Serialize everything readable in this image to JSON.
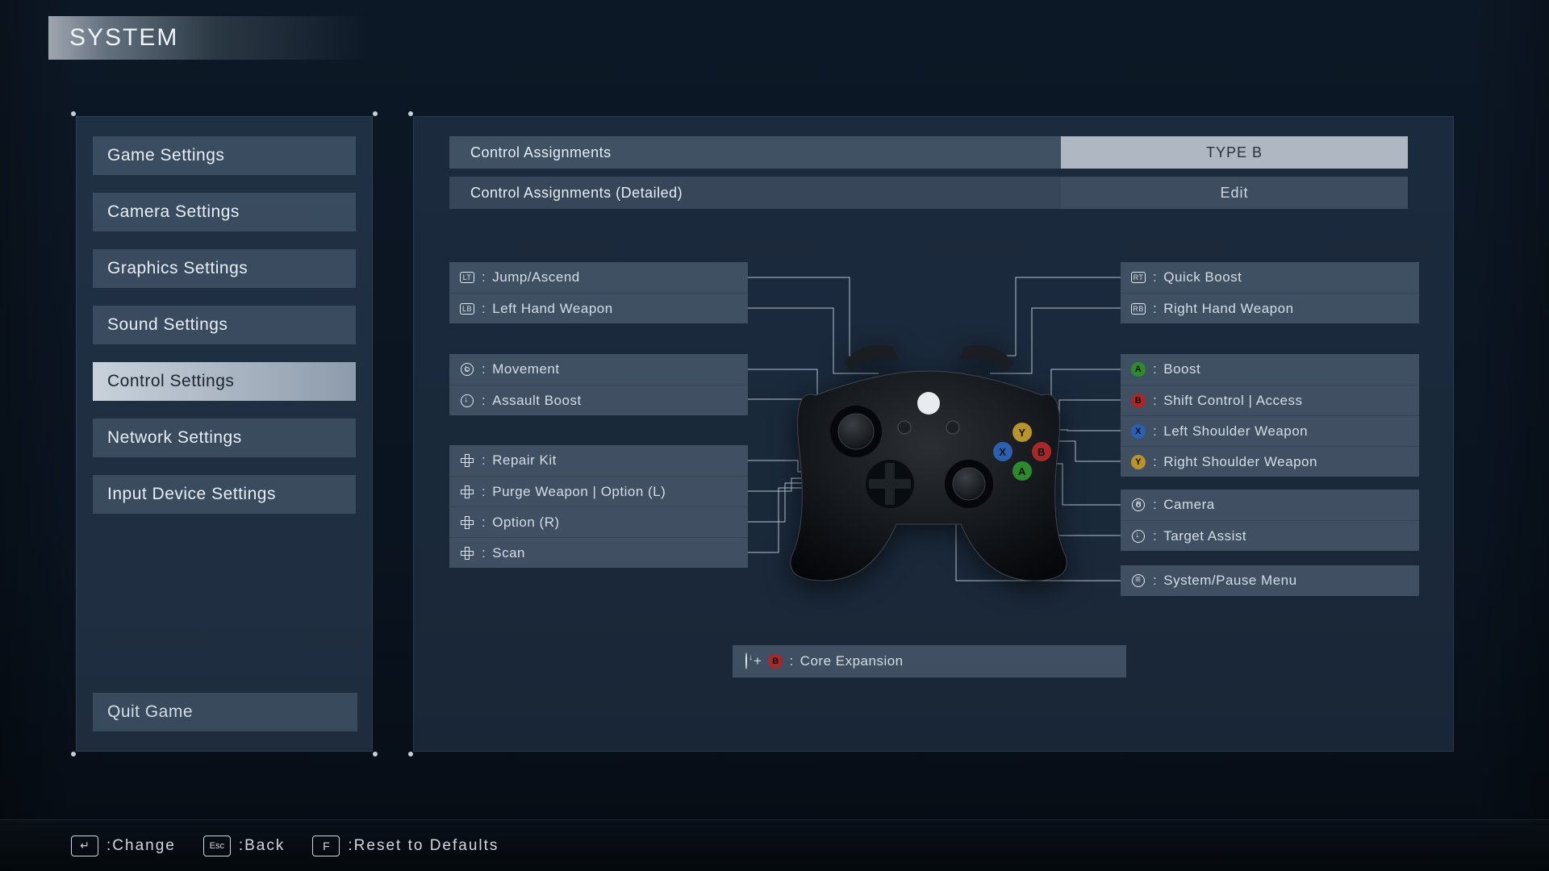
{
  "title": "SYSTEM",
  "sidebar": {
    "items": [
      {
        "label": "Game Settings",
        "active": false
      },
      {
        "label": "Camera Settings",
        "active": false
      },
      {
        "label": "Graphics Settings",
        "active": false
      },
      {
        "label": "Sound Settings",
        "active": false
      },
      {
        "label": "Control Settings",
        "active": true
      },
      {
        "label": "Network Settings",
        "active": false
      },
      {
        "label": "Input Device Settings",
        "active": false
      }
    ],
    "quit": "Quit Game"
  },
  "header": {
    "assignments_label": "Control Assignments",
    "assignments_value": "TYPE B",
    "detailed_label": "Control Assignments (Detailed)",
    "detailed_value": "Edit"
  },
  "bindings": {
    "left": [
      [
        {
          "icon": "LT",
          "label": "Jump/Ascend"
        },
        {
          "icon": "LB",
          "label": "Left Hand Weapon"
        }
      ],
      [
        {
          "icon": "LS",
          "label": "Movement"
        },
        {
          "icon": "LSP",
          "label": "Assault Boost"
        }
      ],
      [
        {
          "icon": "DPAD",
          "label": "Repair Kit"
        },
        {
          "icon": "DPAD",
          "label": "Purge Weapon | Option (L)"
        },
        {
          "icon": "DPAD",
          "label": "Option (R)"
        },
        {
          "icon": "DPAD",
          "label": "Scan"
        }
      ]
    ],
    "right": [
      [
        {
          "icon": "RT",
          "label": "Quick Boost"
        },
        {
          "icon": "RB",
          "label": "Right Hand Weapon"
        }
      ],
      [
        {
          "icon": "A",
          "label": "Boost"
        },
        {
          "icon": "B",
          "label": "Shift Control | Access"
        },
        {
          "icon": "X",
          "label": "Left Shoulder Weapon"
        },
        {
          "icon": "Y",
          "label": "Right Shoulder Weapon"
        }
      ],
      [
        {
          "icon": "RS",
          "label": "Camera"
        },
        {
          "icon": "RSP",
          "label": "Target Assist"
        }
      ],
      [
        {
          "icon": "MENU",
          "label": "System/Pause Menu"
        }
      ]
    ],
    "combo": {
      "parts": [
        "LSP",
        "+",
        "B"
      ],
      "label": "Core Expansion"
    }
  },
  "footer": {
    "change": "Change",
    "back": "Back",
    "reset": "Reset to Defaults",
    "key_change": "↵",
    "key_back": "Esc",
    "key_reset": "F"
  }
}
